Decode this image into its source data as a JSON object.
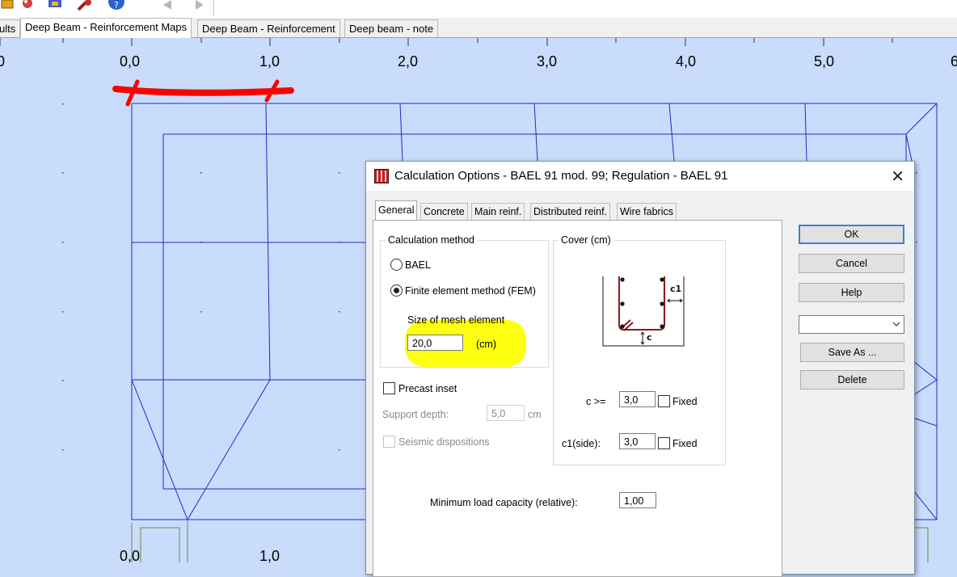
{
  "tabs": [
    {
      "label": "ults"
    },
    {
      "label": "Deep Beam - Reinforcement Maps"
    },
    {
      "label": "Deep Beam - Reinforcement"
    },
    {
      "label": "Deep beam - note"
    }
  ],
  "axis": {
    "top_labels": [
      "0",
      "0,0",
      "1,0",
      "2,0",
      "3,0",
      "4,0",
      "5,0",
      "6"
    ],
    "bottom_labels": [
      "0,0",
      "1,0"
    ]
  },
  "dialog": {
    "title": "Calculation Options - BAEL 91 mod. 99;   Regulation - BAEL 91",
    "tabs": [
      "General",
      "Concrete",
      "Main reinf.",
      "Distributed reinf.",
      "Wire fabrics"
    ],
    "calc_method": {
      "title": "Calculation method",
      "opt_bael": "BAEL",
      "opt_fem": "Finite element method (FEM)",
      "selected": "Finite element method (FEM)",
      "mesh_label": "Size of mesh element",
      "mesh_value": "20,0",
      "mesh_unit": "(cm)"
    },
    "precast": {
      "label": "Precast inset",
      "checked": false
    },
    "support": {
      "label": "Support depth:",
      "value": "5,0",
      "unit": "cm"
    },
    "seismic": {
      "label": "Seismic dispositions",
      "checked": false
    },
    "cover": {
      "title": "Cover (cm)",
      "c_label": "c >=",
      "c_value": "3,0",
      "c_fixed": "Fixed",
      "c1_label": "c1(side):",
      "c1_value": "3,0",
      "c1_fixed": "Fixed",
      "diagram_c": "c",
      "diagram_c1": "c1"
    },
    "min_load": {
      "label": "Minimum load capacity (relative):",
      "value": "1,00"
    },
    "buttons": {
      "ok": "OK",
      "cancel": "Cancel",
      "help": "Help",
      "combo": "",
      "save_as": "Save As ...",
      "delete": "Delete"
    }
  },
  "colors": {
    "canvas": "#c9dcfb",
    "mesh": "#1a2ccc",
    "annotation_red": "#ff0000",
    "highlight": "#ffff10"
  }
}
